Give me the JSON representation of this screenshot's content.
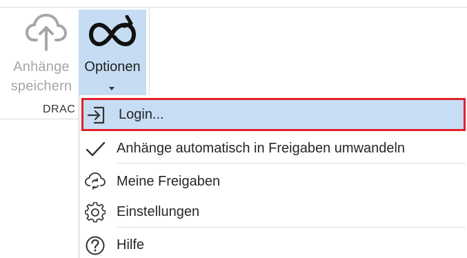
{
  "ribbon": {
    "save_button": {
      "label_line1": "Anhänge",
      "label_line2": "speichern",
      "icon": "cloud-upload-icon"
    },
    "options_button": {
      "label": "Optionen",
      "icon": "infinity-refresh-icon"
    },
    "group_label": "DRAC"
  },
  "menu": {
    "items": [
      {
        "label": "Login...",
        "icon": "login-icon"
      },
      {
        "label": "Anhänge automatisch in Freigaben umwandeln",
        "icon": "checkmark-icon"
      },
      {
        "label": "Meine Freigaben",
        "icon": "cloud-sync-icon"
      },
      {
        "label": "Einstellungen",
        "icon": "gear-icon"
      },
      {
        "label": "Hilfe",
        "icon": "help-icon"
      }
    ]
  },
  "colors": {
    "ribbon_selected_bg": "#c5dcf2",
    "menu_hover_bg": "#c7ddf4",
    "highlight_border": "#e0202a",
    "disabled_text": "#a6a6a6"
  }
}
